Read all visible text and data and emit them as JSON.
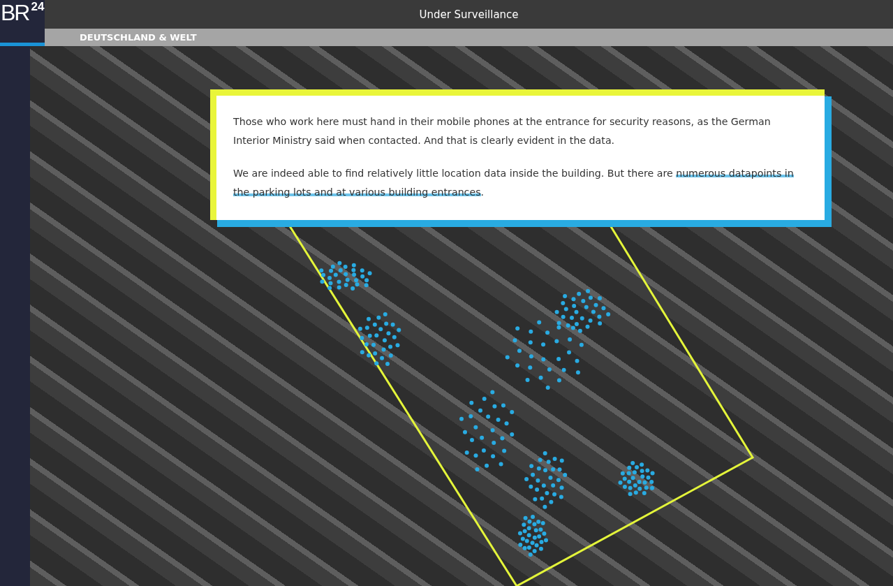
{
  "logo": {
    "main": "BR",
    "sup": "24"
  },
  "header": {
    "title": "Under Surveillance"
  },
  "section": {
    "label": "DEUTSCHLAND & WELT"
  },
  "card": {
    "paragraphs": [
      [
        {
          "text": "Those who work here must hand in their mobile phones at the entrance for security reasons, as the German Interior Ministry said when contacted. And that is clearly evident in the data.",
          "highlighted": false
        }
      ],
      [
        {
          "text": "We are indeed able to find relatively little location data inside the building. But there are ",
          "highlighted": false
        },
        {
          "text": "numerous datapoints in the parking lots and at various building entrances",
          "highlighted": true
        },
        {
          "text": ".",
          "highlighted": false
        }
      ]
    ]
  }
}
